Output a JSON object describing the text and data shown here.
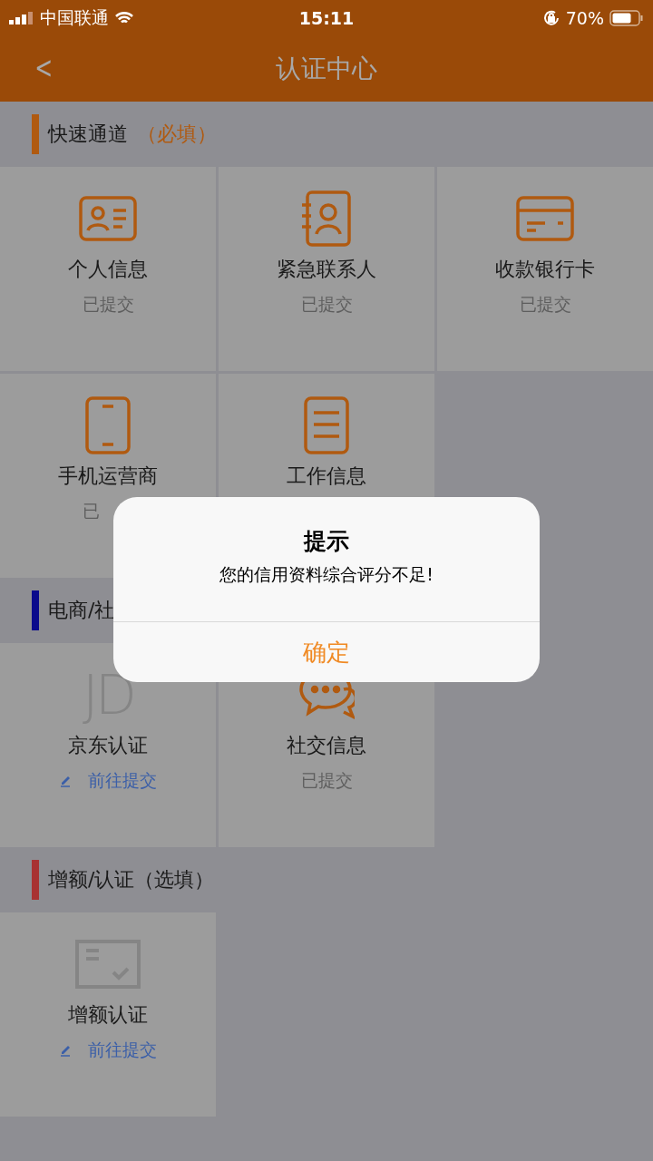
{
  "status_bar": {
    "carrier": "中国联通",
    "time": "15:11",
    "battery": "70%"
  },
  "nav": {
    "back": "<",
    "title": "认证中心"
  },
  "sections": [
    {
      "title": "快速通道",
      "note": "（必填）",
      "color": "#b05a10",
      "tiles": [
        {
          "name": "个人信息",
          "status": "已提交",
          "submitted": true
        },
        {
          "name": "紧急联系人",
          "status": "已提交",
          "submitted": true
        },
        {
          "name": "收款银行卡",
          "status": "已提交",
          "submitted": true
        },
        {
          "name": "手机运营商",
          "status": "已",
          "submitted": true
        },
        {
          "name": "工作信息"
        }
      ]
    },
    {
      "title": "电商/社",
      "color": "#0a0a8c",
      "tiles": [
        {
          "name": "京东认证",
          "logo": "JD",
          "status": "前往提交",
          "submitted": false
        },
        {
          "name": "社交信息",
          "status": "已提交",
          "submitted": true
        }
      ]
    },
    {
      "title": "增额/认证（选填）",
      "color": "#a83232",
      "tiles": [
        {
          "name": "增额认证",
          "status": "前往提交",
          "submitted": false
        }
      ]
    }
  ],
  "dialog": {
    "title": "提示",
    "message": "您的信用资料综合评分不足!",
    "button": "确定"
  }
}
